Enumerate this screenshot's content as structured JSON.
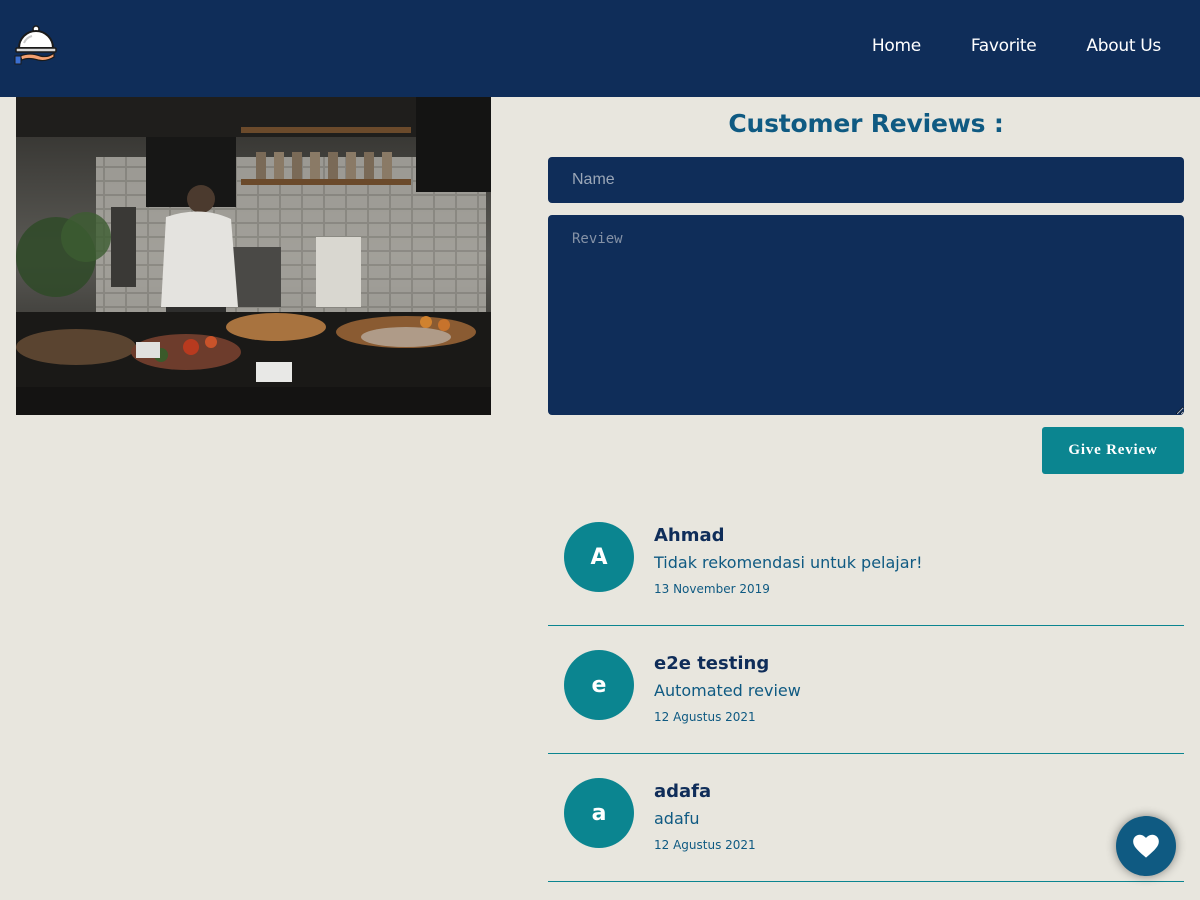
{
  "nav": {
    "home": "Home",
    "favorite": "Favorite",
    "about": "About Us"
  },
  "form": {
    "title": "Customer Reviews :",
    "name_placeholder": "Name",
    "review_placeholder": "Review",
    "submit_label": "Give Review"
  },
  "reviews": [
    {
      "initial": "A",
      "name": "Ahmad",
      "text": "Tidak rekomendasi untuk pelajar!",
      "date": "13 November 2019"
    },
    {
      "initial": "e",
      "name": "e2e testing",
      "text": "Automated review",
      "date": "12 Agustus 2021"
    },
    {
      "initial": "a",
      "name": "adafa",
      "text": "adafu",
      "date": "12 Agustus 2021"
    }
  ],
  "icons": {
    "logo": "food-cloche-logo-icon",
    "fab": "heart-icon"
  },
  "colors": {
    "header": "#0f2d59",
    "accent": "#0b8590",
    "background": "#e8e6de",
    "title": "#0f5a82"
  }
}
